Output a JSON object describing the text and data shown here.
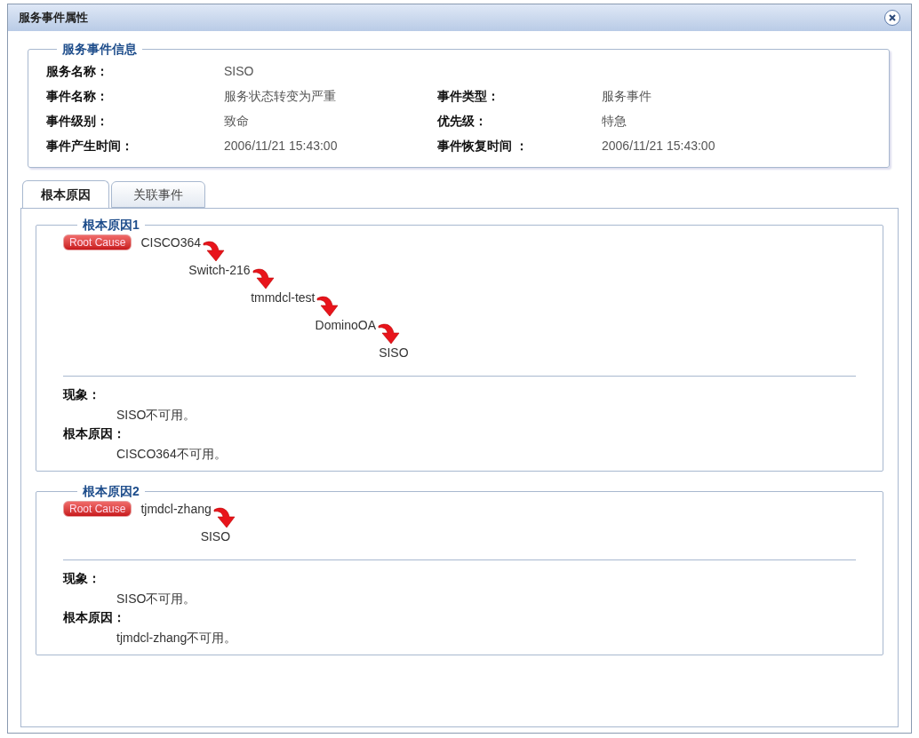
{
  "window": {
    "title": "服务事件属性"
  },
  "info": {
    "legend": "服务事件信息",
    "rows": [
      [
        {
          "label": "服务名称：",
          "value": "SISO"
        }
      ],
      [
        {
          "label": "事件名称：",
          "value": "服务状态转变为严重"
        },
        {
          "label": "事件类型：",
          "value": "服务事件"
        }
      ],
      [
        {
          "label": "事件级别：",
          "value": "致命"
        },
        {
          "label": "优先级：",
          "value": "特急"
        }
      ],
      [
        {
          "label": "事件产生时间：",
          "value": "2006/11/21 15:43:00"
        },
        {
          "label": "事件恢复时间 ：",
          "value": "2006/11/21 15:43:00"
        }
      ]
    ]
  },
  "tabs": [
    {
      "label": "根本原因",
      "selected": true
    },
    {
      "label": "关联事件",
      "selected": false
    }
  ],
  "root_causes": [
    {
      "legend": "根本原因1",
      "badge": "Root Cause",
      "chain": [
        "CISCO364",
        "Switch-216",
        "tmmdcl-test",
        "DominoOA",
        "SISO"
      ],
      "symptom_label": "现象：",
      "symptom": "SISO不可用。",
      "cause_label": "根本原因：",
      "cause": "CISCO364不可用。"
    },
    {
      "legend": "根本原因2",
      "badge": "Root Cause",
      "chain": [
        "tjmdcl-zhang",
        "SISO"
      ],
      "symptom_label": "现象：",
      "symptom": "SISO不可用。",
      "cause_label": "根本原因：",
      "cause": "tjmdcl-zhang不可用。"
    }
  ]
}
